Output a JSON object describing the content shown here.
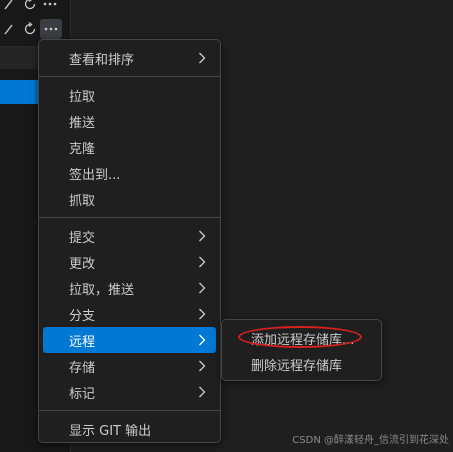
{
  "menu": {
    "items": [
      {
        "label": "查看和排序",
        "submenu": true
      },
      {
        "separator": true
      },
      {
        "label": "拉取"
      },
      {
        "label": "推送"
      },
      {
        "label": "克隆"
      },
      {
        "label": "签出到..."
      },
      {
        "label": "抓取"
      },
      {
        "separator": true
      },
      {
        "label": "提交",
        "submenu": true
      },
      {
        "label": "更改",
        "submenu": true
      },
      {
        "label": "拉取，推送",
        "submenu": true
      },
      {
        "label": "分支",
        "submenu": true
      },
      {
        "label": "远程",
        "submenu": true,
        "active": true
      },
      {
        "label": "存储",
        "submenu": true
      },
      {
        "label": "标记",
        "submenu": true
      },
      {
        "separator": true
      },
      {
        "label": "显示 GIT 输出"
      }
    ]
  },
  "submenu": {
    "items": [
      {
        "label": "添加远程存储库..."
      },
      {
        "label": "删除远程存储库"
      }
    ]
  },
  "icons": {
    "check": "check-icon",
    "refresh": "refresh-icon",
    "more": "ellipsis-icon",
    "chevron": "chevron-right-icon"
  },
  "colors": {
    "accent": "#0078d4",
    "annotation": "#d8201c"
  },
  "watermark": "CSDN @醉漾轻舟_信流引到花深处"
}
